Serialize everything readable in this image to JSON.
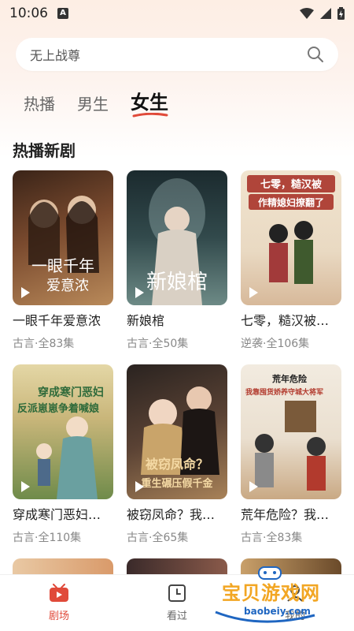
{
  "status": {
    "time": "10:06",
    "notify_letter": "A"
  },
  "search": {
    "placeholder": "无上战尊"
  },
  "tabs": [
    {
      "label": "热播",
      "active": false
    },
    {
      "label": "男生",
      "active": false
    },
    {
      "label": "女生",
      "active": true
    }
  ],
  "section": {
    "title": "热播新剧"
  },
  "dramas": [
    {
      "title": "一眼千年爱意浓",
      "meta": "古言·全83集",
      "poster_text": "一眼千年爱意浓",
      "colors": [
        "#3a2418",
        "#b98a5a"
      ]
    },
    {
      "title": "新娘棺",
      "meta": "古言·全50集",
      "poster_text": "新娘棺",
      "colors": [
        "#1b2a2e",
        "#6d8a86"
      ]
    },
    {
      "title": "七零，糙汉被…",
      "meta": "逆袭·全106集",
      "poster_text": "七零，糙汉被作精媳妇撩翻了",
      "colors": [
        "#e9d9c2",
        "#b0453a"
      ]
    },
    {
      "title": "穿成寒门恶妇…",
      "meta": "古言·全110集",
      "poster_text": "穿成寒门恶妇 反派崽崽争着喊娘",
      "colors": [
        "#c9b67a",
        "#6f8b4a"
      ]
    },
    {
      "title": "被窃凤命？我…",
      "meta": "古言·全65集",
      "poster_text": "被窃凤命？重生碾压假千金",
      "colors": [
        "#2a2320",
        "#a88258"
      ]
    },
    {
      "title": "荒年危险？我…",
      "meta": "古言·全83集",
      "poster_text": "荒年危险 我靠囤货娇养守城大将军",
      "colors": [
        "#eadfcf",
        "#b23a2d"
      ]
    }
  ],
  "bottom_nav": [
    {
      "label": "剧场",
      "icon": "theater-icon",
      "active": true
    },
    {
      "label": "看过",
      "icon": "history-icon",
      "active": false
    },
    {
      "label": "我的",
      "icon": "profile-icon",
      "active": false
    }
  ],
  "watermark": {
    "text": "宝贝游戏网",
    "url": "baobeiy.com"
  },
  "colors": {
    "accent": "#e04a3a",
    "watermark_orange": "#f2a623",
    "watermark_blue": "#1f66c1"
  }
}
